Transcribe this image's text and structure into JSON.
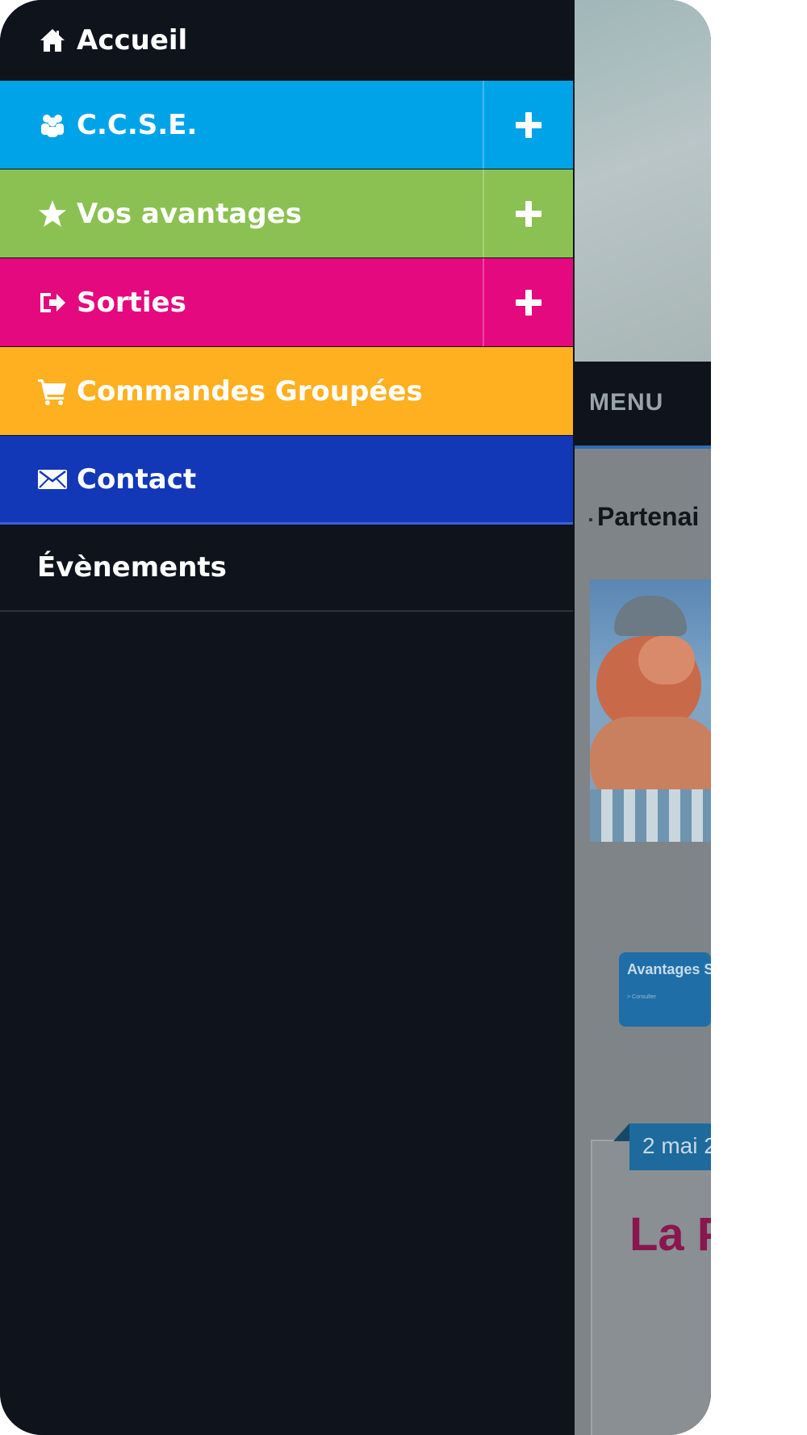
{
  "drawer": {
    "items": [
      {
        "label": "Accueil",
        "icon": "home-icon",
        "expandable": false
      },
      {
        "label": "C.C.S.E.",
        "icon": "group-icon",
        "expandable": true,
        "color": "#00a3e8"
      },
      {
        "label": "Vos avantages",
        "icon": "star-icon",
        "expandable": true,
        "color": "#8bc152"
      },
      {
        "label": "Sorties",
        "icon": "sign-out-icon",
        "expandable": true,
        "color": "#e4097f"
      },
      {
        "label": "Commandes Groupées",
        "icon": "cart-icon",
        "expandable": false,
        "color": "#ffb020"
      },
      {
        "label": "Contact",
        "icon": "envelope-icon",
        "expandable": false,
        "color": "#1238b8"
      },
      {
        "label": "Évènements",
        "icon": "",
        "expandable": false
      }
    ]
  },
  "page": {
    "menu_label": "MENU",
    "section_title": "Partenai",
    "promo_title": "Avantages Sociaux",
    "promo_subtitle": "> Consulter",
    "date_tag": "2 mai 2",
    "headline": "La Pa"
  }
}
